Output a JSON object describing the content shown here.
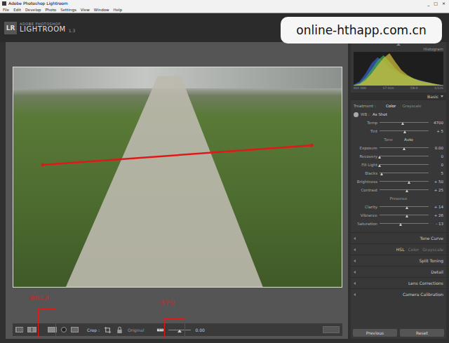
{
  "window": {
    "title": "Adobe Photoshop Lightroom",
    "controls": [
      "_",
      "□",
      "×"
    ]
  },
  "menu": [
    "File",
    "Edit",
    "Develop",
    "Photo",
    "Settings",
    "View",
    "Window",
    "Help"
  ],
  "logo": {
    "badge": "LR",
    "brand": "ADOBE PHOTOSHOP",
    "product": "LIGHTROOM",
    "version": "1.3"
  },
  "watermark": "online-hthapp.com.cn",
  "histogram": {
    "title": "Histogram",
    "series": [
      {
        "name": "blue",
        "color": "#3c5cd0",
        "values": [
          2,
          10,
          30,
          55,
          70,
          60,
          45,
          35,
          28,
          22,
          18,
          14,
          10,
          6,
          3,
          1
        ]
      },
      {
        "name": "green",
        "color": "#3fae4a",
        "values": [
          1,
          6,
          20,
          40,
          62,
          75,
          60,
          42,
          30,
          24,
          18,
          12,
          8,
          5,
          2,
          1
        ]
      },
      {
        "name": "red",
        "color": "#d8c23a",
        "values": [
          1,
          4,
          14,
          30,
          50,
          68,
          80,
          58,
          38,
          26,
          18,
          12,
          9,
          6,
          3,
          1
        ]
      }
    ],
    "readouts": [
      "ISO 100",
      "17 mm",
      "f/8.0",
      "1/125"
    ]
  },
  "basic": {
    "title": "Basic",
    "rows": [
      {
        "kind": "toggle",
        "label": "Treatment :",
        "options": [
          {
            "label": "Color",
            "selected": true
          },
          {
            "label": "Grayscale",
            "selected": false
          }
        ]
      },
      {
        "kind": "select",
        "label": "WB :",
        "value": "As Shot"
      },
      {
        "kind": "slider",
        "label": "Temp",
        "value": "4700",
        "level": 0.48
      },
      {
        "kind": "slider",
        "label": "Tint",
        "value": "+ 5",
        "level": 0.52
      },
      {
        "kind": "header",
        "label": "Tone",
        "action": "Auto"
      },
      {
        "kind": "slider",
        "label": "Exposure",
        "value": "0.00",
        "level": 0.5
      },
      {
        "kind": "slider",
        "label": "Recovery",
        "value": "0",
        "level": 0.0
      },
      {
        "kind": "slider",
        "label": "Fill Light",
        "value": "0",
        "level": 0.0
      },
      {
        "kind": "slider",
        "label": "Blacks",
        "value": "5",
        "level": 0.05
      },
      {
        "kind": "slider",
        "label": "Brightness",
        "value": "+ 50",
        "level": 0.6
      },
      {
        "kind": "slider",
        "label": "Contrast",
        "value": "+ 25",
        "level": 0.56
      },
      {
        "kind": "header",
        "label": "Presence"
      },
      {
        "kind": "slider",
        "label": "Clarity",
        "value": "+ 14",
        "level": 0.57
      },
      {
        "kind": "slider",
        "label": "Vibrance",
        "value": "+ 26",
        "level": 0.57
      },
      {
        "kind": "slider",
        "label": "Saturation",
        "value": "- 13",
        "level": 0.44
      }
    ]
  },
  "panels": [
    {
      "label": "Tone Curve"
    },
    {
      "label": "HSL",
      "tabs": [
        "Color",
        "Grayscale"
      ]
    },
    {
      "label": "Split Toning"
    },
    {
      "label": "Detail"
    },
    {
      "label": "Lens Corrections"
    },
    {
      "label": "Camera Calibration"
    }
  ],
  "toolbar": {
    "crop_label": "Crop :",
    "aspect": "Original",
    "straighten": {
      "level": 0.5,
      "value": "0.00"
    }
  },
  "annotations": [
    {
      "text": "裁剪工具"
    },
    {
      "text": "水平仪"
    }
  ],
  "buttons": [
    "Previous",
    "Reset"
  ]
}
